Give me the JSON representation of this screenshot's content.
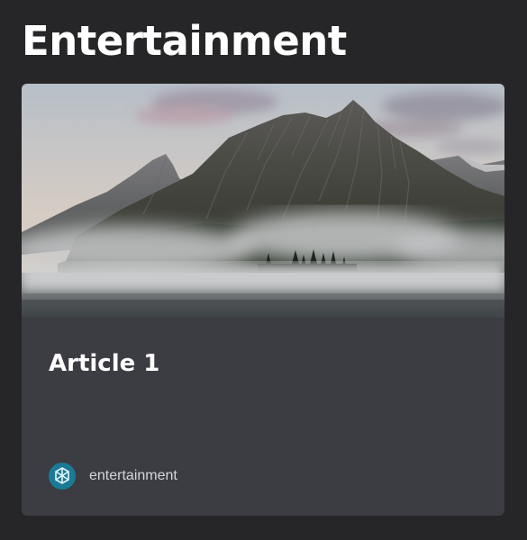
{
  "page": {
    "title": "Entertainment"
  },
  "article": {
    "title": "Article 1",
    "category": "entertainment",
    "image": "misty-mountain-lake-photo"
  },
  "colors": {
    "background": "#262628",
    "card": "#3c3c43",
    "text": "#ffffff",
    "muted_text": "#d6d6dc",
    "avatar": "#1b7a96"
  }
}
